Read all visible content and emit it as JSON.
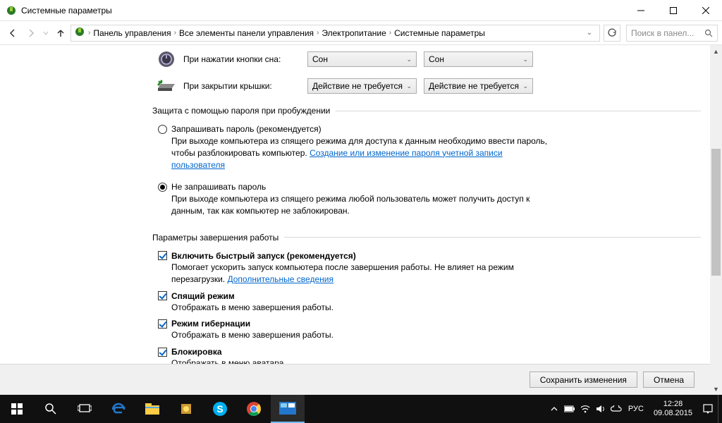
{
  "window": {
    "title": "Системные параметры"
  },
  "breadcrumb": {
    "items": [
      "Панель управления",
      "Все элементы панели управления",
      "Электропитание",
      "Системные параметры"
    ]
  },
  "search": {
    "placeholder": "Поиск в панел..."
  },
  "settings": {
    "sleep_button": {
      "label": "При нажатии кнопки сна:",
      "battery": "Сон",
      "plugged": "Сон"
    },
    "lid_close": {
      "label": "При закрытии крышки:",
      "battery": "Действие не требуется",
      "plugged": "Действие не требуется"
    }
  },
  "password_section": {
    "title": "Защита с помощью пароля при пробуждении",
    "require": {
      "label": "Запрашивать пароль (рекомендуется)",
      "desc_before": "При выходе компьютера из спящего режима для доступа к данным необходимо ввести пароль, чтобы разблокировать компьютер. ",
      "link": "Создание или изменение пароля учетной записи пользователя"
    },
    "norequire": {
      "label": "Не запрашивать пароль",
      "desc": "При выходе компьютера из спящего режима любой пользователь может получить доступ к данным, так как компьютер не заблокирован."
    }
  },
  "shutdown_section": {
    "title": "Параметры завершения работы",
    "fast": {
      "label": "Включить быстрый запуск (рекомендуется)",
      "desc_before": "Помогает ускорить запуск компьютера после завершения работы. Не влияет на режим перезагрузки. ",
      "link": "Дополнительные сведения"
    },
    "sleep": {
      "label": "Спящий режим",
      "desc": "Отображать в меню завершения работы."
    },
    "hibernate": {
      "label": "Режим гибернации",
      "desc": "Отображать в меню завершения работы."
    },
    "lock": {
      "label": "Блокировка",
      "desc": "Отображать в меню аватара."
    }
  },
  "buttons": {
    "save": "Сохранить изменения",
    "cancel": "Отмена"
  },
  "tray": {
    "lang": "РУС",
    "time": "12:28",
    "date": "09.08.2015"
  }
}
